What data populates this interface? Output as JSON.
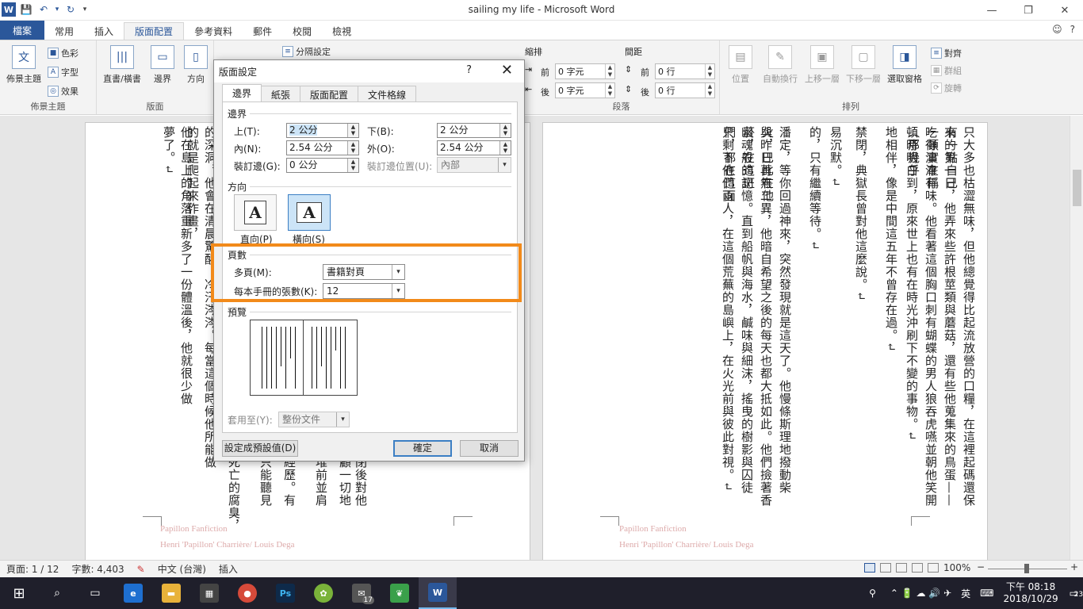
{
  "window": {
    "title": "sailing my life  -  Microsoft Word",
    "min": "—",
    "restore": "❐",
    "close": "✕"
  },
  "qat": {
    "save": "💾",
    "undo": "↶",
    "undo_dd": "▾",
    "redo": "↻",
    "customize": "▾"
  },
  "tabs": [
    "檔案",
    "常用",
    "插入",
    "版面配置",
    "參考資料",
    "郵件",
    "校閱",
    "檢視"
  ],
  "tabs_right": {
    "smiley": "☺",
    "help": "?"
  },
  "ribbon": {
    "theme_group": {
      "label": "佈景主題",
      "themes": "佈景主題",
      "colors": "色彩",
      "fonts": "字型",
      "effects": "效果"
    },
    "page_setup_group": {
      "label": "版面",
      "text_direction": "直書/橫書",
      "margins": "邊界",
      "orientation": "方向",
      "breaks": "分隔設定"
    },
    "paragraph_group": {
      "label": "段落",
      "indent": "縮排",
      "spacing": "間距",
      "before": "前",
      "after": "後",
      "indent_before_val": "0 字元",
      "indent_after_val": "0 字元",
      "spacing_before_val": "0 行",
      "spacing_after_val": "0 行"
    },
    "arrange_group": {
      "label": "排列",
      "position": "位置",
      "wrap": "自動換行",
      "forward": "上移一層",
      "backward": "下移一層",
      "selection_pane": "選取窗格",
      "align": "對齊",
      "group": "群組",
      "rotate": "旋轉"
    }
  },
  "document": {
    "left_page_cols": [
      "他在島上的角落重新多了一份體溫後，他就很少做夢了。↵",
      "的深洞，他會在清晨驚醒，冷汗涔涔。每當這個時候他所能做的就是爬起來作畫，",
      "死亡的腐臭，",
      "只能聽見",
      "經歷。有",
      "堆前並肩",
      "顧一切地",
      "閉後對他"
    ],
    "right_page_cols": [
      "只大多也枯澀無味，但他總覺得比起流放營的口糧，在這裡起碼還保有一點自己",
      "來的第一日，他弄來些許根莖類與蘑菇，還有些他蒐集來的鳥蛋——一頓實在稱",
      "吃得津津有味。他看著這個胸口刺有蝴蝶的男人狼吞虎嚥並朝他笑開（那幾乎",
      "頓時明白到，原來世上也有在時光沖刷下不變的事物。↵",
      "地相伴，像是中間這五年不曾存在過。↵",
      "禁閉，典獄長曾對他這麼說。↵",
      "易沉默。↵",
      "的，只有繼續等待。↵",
      "潘定，等你回過神來，突然發現就是這天了。他慢條斯理地撥動柴火，巴比在他",
      "與昨日再無二異，他暗自希望之後的每天也都大抵如此。他們撿著香菸，在這斑",
      "幽魂般的記憶。直到船帆與海水，鹹味與細沫，搖曳的樹影與囚徒們，都在這面",
      "只剩下他們兩人，在這個荒蕪的島嶼上，在火光前與彼此對視。↵"
    ],
    "footer1": "Papillon Fanfiction",
    "footer2": "Henri 'Papillon' Charrière/ Louis Dega"
  },
  "dialog": {
    "title": "版面設定",
    "help": "?",
    "close": "✕",
    "tabs": [
      "邊界",
      "紙張",
      "版面配置",
      "文件格線"
    ],
    "margins_section": "邊界",
    "top_label": "上(T):",
    "top_val": "2 公分",
    "bottom_label": "下(B):",
    "bottom_val": "2 公分",
    "inside_label": "內(N):",
    "inside_val": "2.54 公分",
    "outside_label": "外(O):",
    "outside_val": "2.54 公分",
    "gutter_label": "裝訂邊(G):",
    "gutter_val": "0 公分",
    "gutter_pos_label": "裝訂邊位置(U):",
    "gutter_pos_val": "內部",
    "orientation_section": "方向",
    "portrait": "直向(P)",
    "landscape": "橫向(S)",
    "pages_section": "頁數",
    "multiple_pages_label": "多頁(M):",
    "multiple_pages_val": "書籍對頁",
    "sheets_label": "每本手冊的張數(K):",
    "sheets_val": "12",
    "preview_section": "預覽",
    "apply_label": "套用至(Y):",
    "apply_val": "整份文件",
    "set_default": "設定成預設值(D)",
    "ok": "確定",
    "cancel": "取消"
  },
  "status": {
    "page": "頁面: 1 / 12",
    "words": "字數: 4,403",
    "lang": "中文 (台灣)",
    "mode": "插入",
    "zoom": "100%",
    "zoom_minus": "−",
    "zoom_plus": "+"
  },
  "taskbar": {
    "time": "下午 08:18",
    "date": "2018/10/29",
    "ime": "英",
    "mail_badge": "17",
    "notif_count": "23",
    "tray_icons": "⌃ 🔋 ☁ 🔊 ✈"
  },
  "colors": {
    "accent": "#2b579a",
    "highlight": "#f28a1a"
  }
}
